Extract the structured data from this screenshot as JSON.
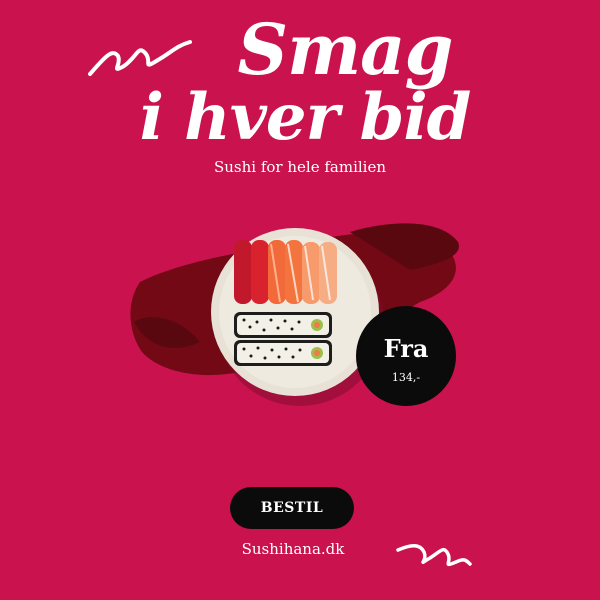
{
  "headline": {
    "line1": "Smag",
    "line2": "i hver bid"
  },
  "subtitle": "Sushi for hele familien",
  "badge": {
    "label": "Fra",
    "price": "134,-"
  },
  "cta": {
    "label": "BESTIL"
  },
  "website": "Sushihana.dk",
  "colors": {
    "background": "#c9124e",
    "text": "#ffffff",
    "badge": "#0b0b0b",
    "brush": "#6e0a12"
  },
  "image": {
    "description_icon": "sushi-plate-image"
  }
}
